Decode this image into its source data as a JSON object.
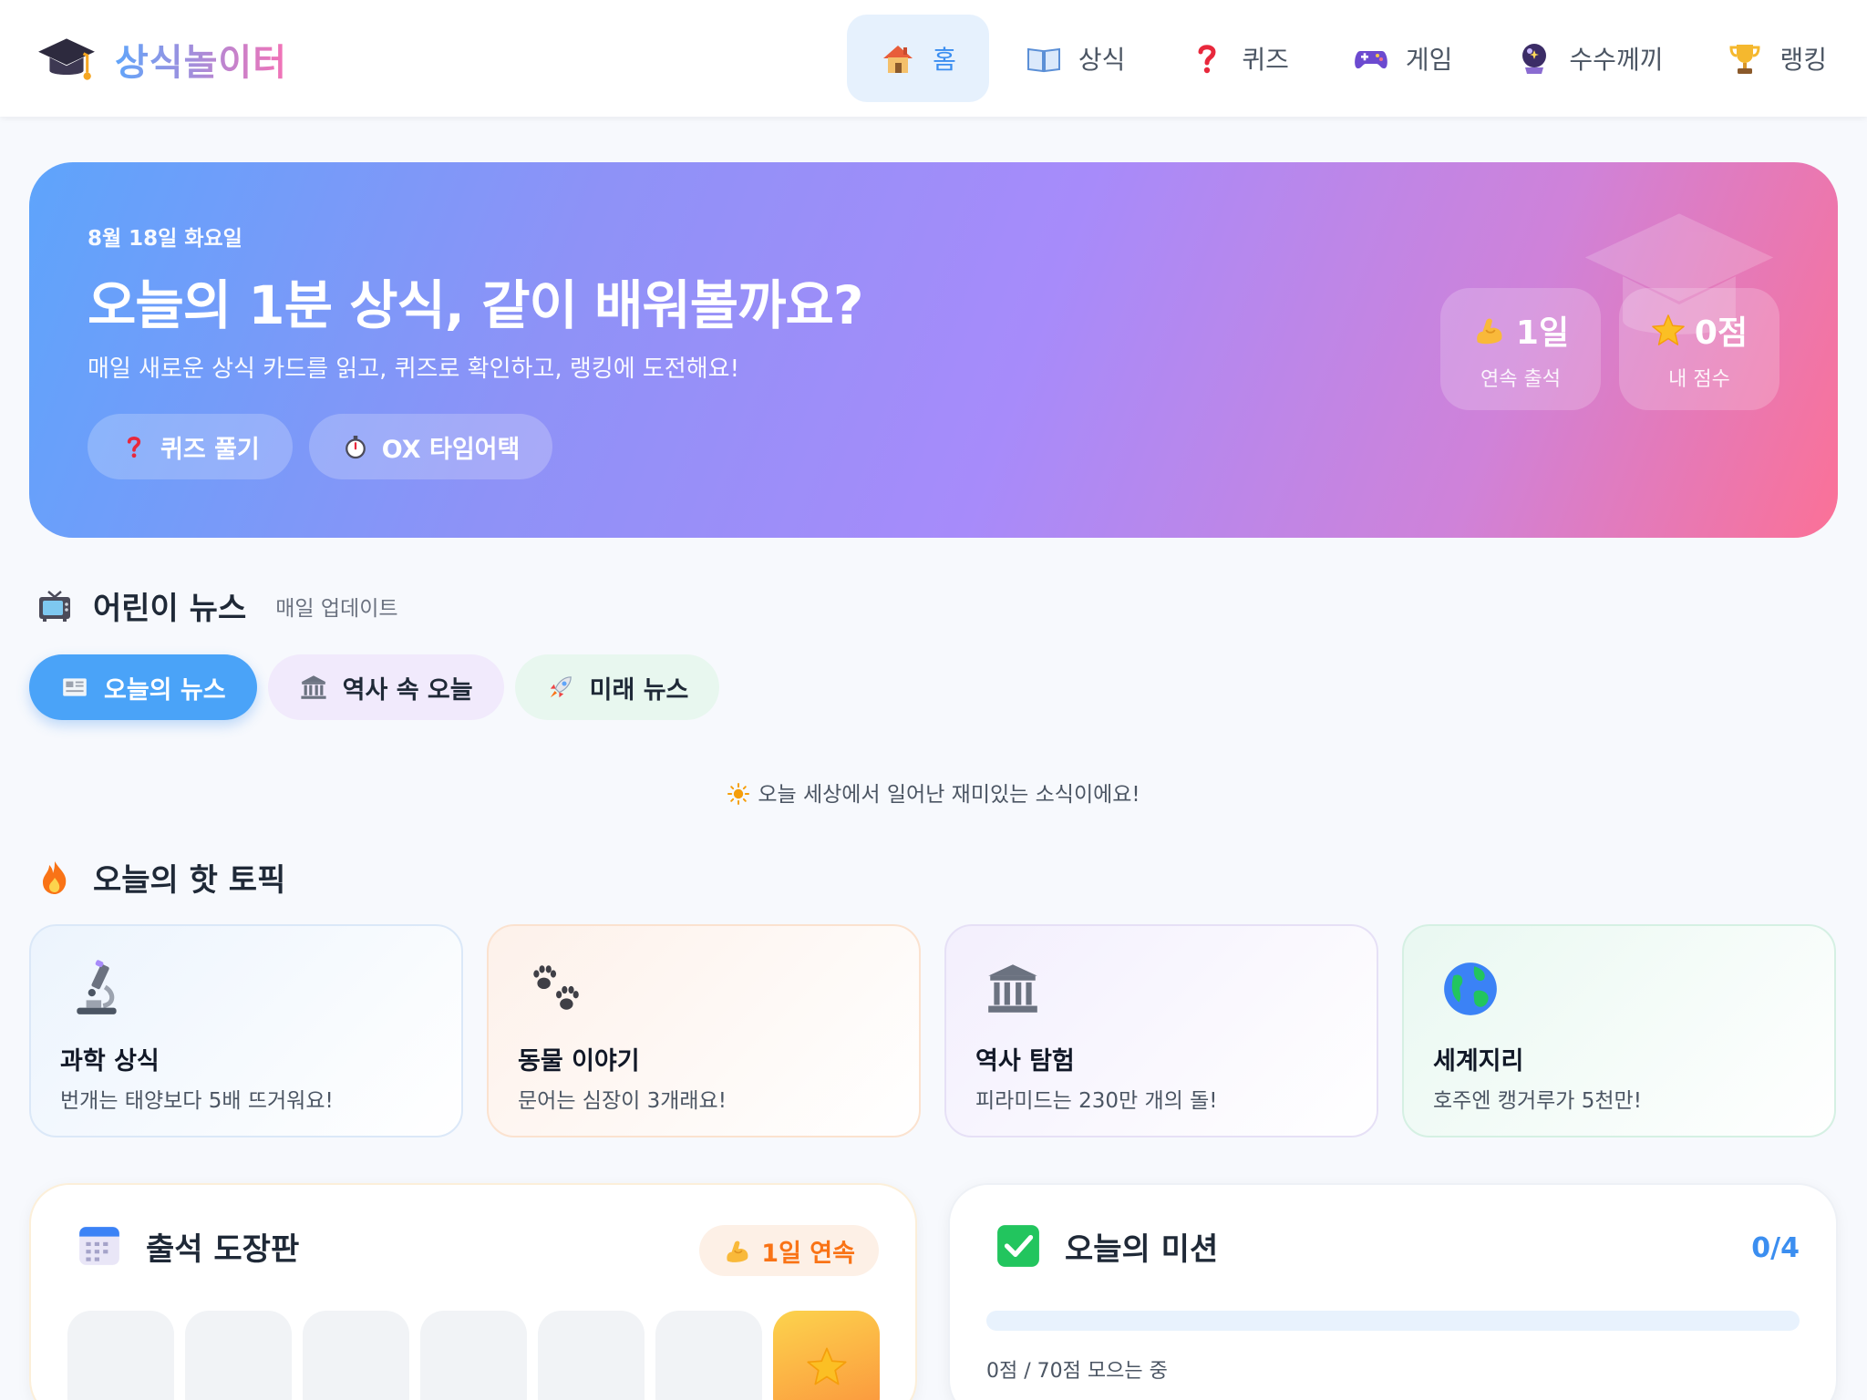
{
  "app": {
    "logo_text": "상식놀이터",
    "logo_icon": "graduation-cap-icon"
  },
  "nav": {
    "items": [
      {
        "label": "홈",
        "icon": "house-icon",
        "active": true
      },
      {
        "label": "상식",
        "icon": "open-book-icon",
        "active": false
      },
      {
        "label": "퀴즈",
        "icon": "question-mark-icon",
        "active": false
      },
      {
        "label": "게임",
        "icon": "game-controller-icon",
        "active": false
      },
      {
        "label": "수수께끼",
        "icon": "crystal-ball-icon",
        "active": false
      },
      {
        "label": "랭킹",
        "icon": "trophy-icon",
        "active": false
      }
    ]
  },
  "hero": {
    "date": "8월 18일 화요일",
    "title": "오늘의 1분 상식, 같이 배워볼까요?",
    "subtitle": "매일 새로운 상식 카드를 읽고, 퀴즈로 확인하고, 랭킹에 도전해요!",
    "buttons": [
      {
        "label": "퀴즈 풀기",
        "icon": "question-mark-icon"
      },
      {
        "label": "OX 타임어택",
        "icon": "stopwatch-icon"
      }
    ],
    "stats": [
      {
        "value": "1일",
        "label": "연속 출석",
        "icon": "flexed-biceps-icon"
      },
      {
        "value": "0점",
        "label": "내 점수",
        "icon": "star-icon"
      }
    ]
  },
  "news": {
    "title": "어린이 뉴스",
    "badge": "매일 업데이트",
    "icon": "television-icon",
    "tabs": [
      {
        "label": "오늘의 뉴스",
        "icon": "newspaper-icon",
        "active": true
      },
      {
        "label": "역사 속 오늘",
        "icon": "classical-building-icon",
        "active": false
      },
      {
        "label": "미래 뉴스",
        "icon": "rocket-icon",
        "active": false
      }
    ],
    "message": "오늘 세상에서 일어난 재미있는 소식이에요!",
    "message_icon": "sun-icon"
  },
  "topics": {
    "title": "오늘의 핫 토픽",
    "icon": "fire-icon",
    "items": [
      {
        "title": "과학 상식",
        "desc": "번개는 태양보다 5배 뜨거워요!",
        "icon": "microscope-icon"
      },
      {
        "title": "동물 이야기",
        "desc": "문어는 심장이 3개래요!",
        "icon": "paw-prints-icon"
      },
      {
        "title": "역사 탐험",
        "desc": "피라미드는 230만 개의 돌!",
        "icon": "classical-building-icon"
      },
      {
        "title": "세계지리",
        "desc": "호주엔 캥거루가 5천만!",
        "icon": "globe-icon"
      }
    ]
  },
  "attendance": {
    "title": "출석 도장판",
    "icon": "calendar-icon",
    "streak": "1일 연속",
    "streak_icon": "flexed-biceps-icon",
    "stamps": [
      false,
      false,
      false,
      false,
      false,
      false,
      true
    ]
  },
  "mission": {
    "title": "오늘의 미션",
    "icon": "check-mark-icon",
    "count": "0/4",
    "progress": 0,
    "progress_text": "0점 / 70점 모으는 중"
  },
  "colors": {
    "accent": "#3b8ef0",
    "hero_start": "#5ea4fb",
    "hero_end": "#fb7197",
    "streak": "#f97316"
  }
}
